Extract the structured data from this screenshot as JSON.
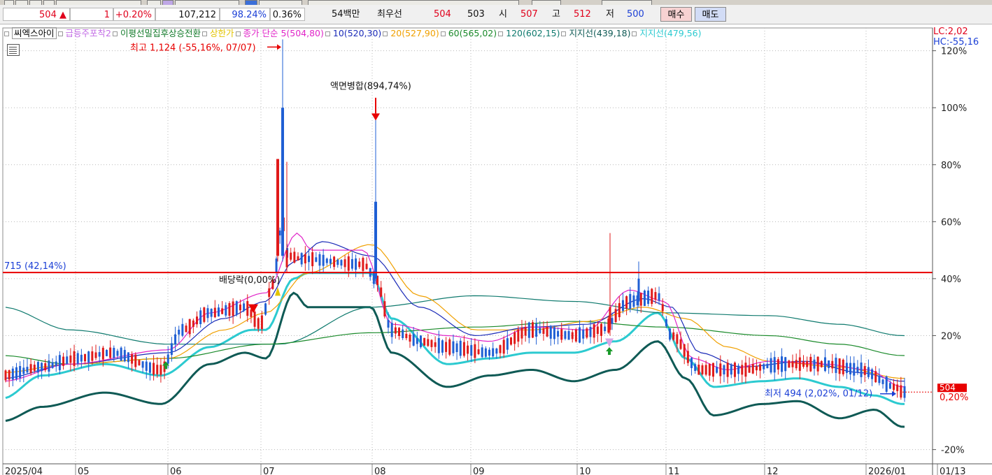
{
  "ticker_bar": {
    "price": "504",
    "change_arrow": "▲",
    "change": "1",
    "change_pct": "+0.20%",
    "volume": "107,212",
    "volume_ratio": "98.24%",
    "turnover": "0.36%",
    "amount": "54백만",
    "best_label": "최우선",
    "best_ask": "504",
    "best_bid": "503",
    "open_label": "시",
    "open": "507",
    "high_label": "고",
    "high": "512",
    "low_label": "저",
    "low": "500",
    "buy_label": "매수",
    "sell_label": "매도"
  },
  "legend": {
    "items": [
      {
        "text": "씨엑스아이",
        "color": "#000000"
      },
      {
        "text": "급등주포착2",
        "color": "#c36ee6"
      },
      {
        "text": "이평선밀집후상승전환",
        "color": "#127a2a"
      },
      {
        "text": "상한가",
        "color": "#e3c400"
      },
      {
        "text": "종가 단순 5(504,80)",
        "color": "#e024c8"
      },
      {
        "text": "10(520,30)",
        "color": "#1b2bb8"
      },
      {
        "text": "20(527,90)",
        "color": "#f0a000"
      },
      {
        "text": "60(565,02)",
        "color": "#1a8a2a"
      },
      {
        "text": "120(602,15)",
        "color": "#0f7a6e"
      },
      {
        "text": "지지선(439,18)",
        "color": "#0f5a55"
      },
      {
        "text": "지지선(479,56)",
        "color": "#2ccad0"
      }
    ]
  },
  "lc_label": "LC:2,02",
  "hc_label": "HC:-55,16",
  "chart_data": {
    "type": "candlestick",
    "y_unit": "% from last price",
    "ylim": [
      -25,
      128
    ],
    "y_ticks": [
      {
        "v": 120,
        "label": "120%"
      },
      {
        "v": 100,
        "label": "100%"
      },
      {
        "v": 80,
        "label": "80%"
      },
      {
        "v": 60,
        "label": "60%"
      },
      {
        "v": 40,
        "label": "40%"
      },
      {
        "v": 20,
        "label": "20%"
      },
      {
        "v": -20,
        "label": "-20%"
      }
    ],
    "x_labels": [
      "2025/04",
      "05",
      "06",
      "07",
      "08",
      "09",
      "10",
      "11",
      "12",
      "2026/01",
      "01/13"
    ],
    "horizontal_line": {
      "value": 42.14,
      "label": "715 (42,14%)"
    },
    "current_price": {
      "value": 0.2,
      "price_label": "504",
      "pct_label": "0,20%"
    },
    "annotations": {
      "high": "최고 1,124 (-55,16%, 07/07)",
      "split": "액면병합(894,74%)",
      "dividend": "배당락(0,00%)",
      "low": "최저 494 (2,02%, 01/12)"
    },
    "price_peaks": [
      {
        "date": "2025/07/07",
        "high": 124,
        "close": 100
      },
      {
        "date": "2025/08",
        "high": 96,
        "close": 67
      },
      {
        "date": "2025/10",
        "high": 56,
        "close": 25
      },
      {
        "date": "2026/01/12",
        "low": 2.02
      }
    ],
    "ma_values": {
      "ma5": 504.8,
      "ma10": 520.3,
      "ma20": 527.9,
      "ma60": 565.02,
      "ma120": 602.15
    },
    "support_values": {
      "support1": 439.18,
      "support2": 479.56
    }
  }
}
